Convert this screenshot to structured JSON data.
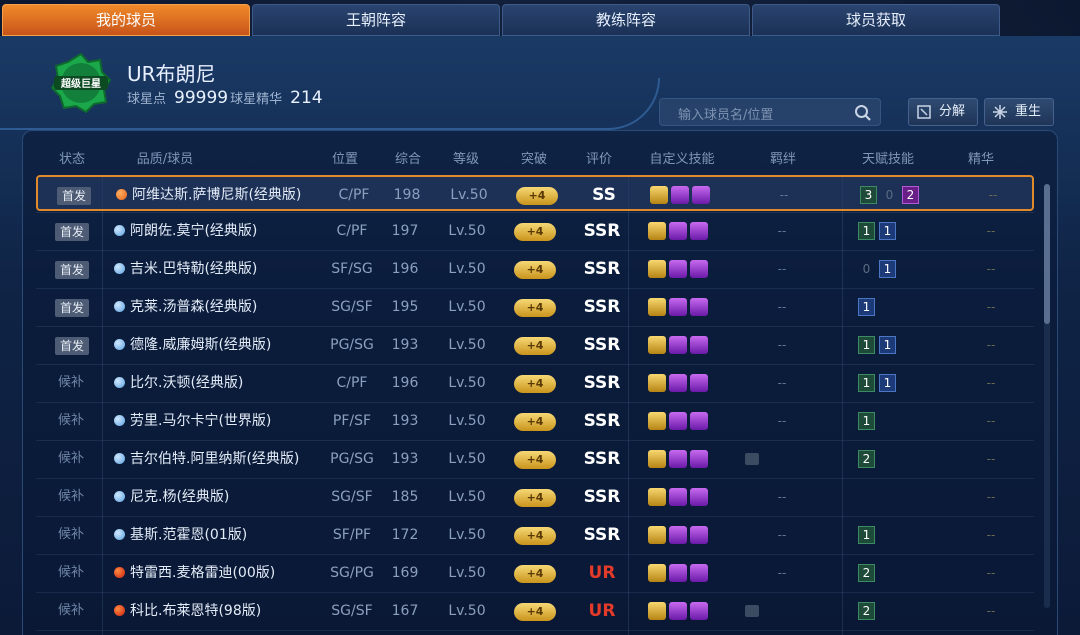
{
  "tabs": [
    "我的球员",
    "王朝阵容",
    "教练阵容",
    "球员获取"
  ],
  "player": {
    "badge_text": "超级巨星",
    "name": "UR布朗尼",
    "star_points_label": "球星点",
    "star_points": "99999",
    "essence_label": "球星精华",
    "essence": "214"
  },
  "search": {
    "placeholder": "输入球员名/位置"
  },
  "buttons": {
    "decompose": "分解",
    "rebirth": "重生"
  },
  "columns": [
    "状态",
    "品质/球员",
    "位置",
    "综合",
    "等级",
    "突破",
    "评价",
    "自定义技能",
    "羁绊",
    "天赋技能",
    "精华"
  ],
  "rows": [
    {
      "status": "首发",
      "name": "阿维达斯.萨博尼斯(经典版)",
      "dot": "orange",
      "pos": "C/PF",
      "ovr": "198",
      "lv": "Lv.50",
      "brk": "+4",
      "grade": "SS",
      "bond": "--",
      "talents": [
        [
          "g",
          "3"
        ],
        [
          "z",
          "0"
        ],
        [
          "p",
          "2"
        ]
      ],
      "ess": "--"
    },
    {
      "status": "首发",
      "name": "阿朗佐.莫宁(经典版)",
      "dot": "blue",
      "pos": "C/PF",
      "ovr": "197",
      "lv": "Lv.50",
      "brk": "+4",
      "grade": "SSR",
      "bond": "--",
      "talents": [
        [
          "g",
          "1"
        ],
        [
          "b",
          "1"
        ]
      ],
      "ess": "--"
    },
    {
      "status": "首发",
      "name": "吉米.巴特勒(经典版)",
      "dot": "blue",
      "pos": "SF/SG",
      "ovr": "196",
      "lv": "Lv.50",
      "brk": "+4",
      "grade": "SSR",
      "bond": "--",
      "talents": [
        [
          "z",
          "0"
        ],
        [
          "b",
          "1"
        ]
      ],
      "ess": "--"
    },
    {
      "status": "首发",
      "name": "克莱.汤普森(经典版)",
      "dot": "blue",
      "pos": "SG/SF",
      "ovr": "195",
      "lv": "Lv.50",
      "brk": "+4",
      "grade": "SSR",
      "bond": "--",
      "talents": [
        [
          "b",
          "1"
        ]
      ],
      "ess": "--"
    },
    {
      "status": "首发",
      "name": "德隆.威廉姆斯(经典版)",
      "dot": "blue",
      "pos": "PG/SG",
      "ovr": "193",
      "lv": "Lv.50",
      "brk": "+4",
      "grade": "SSR",
      "bond": "--",
      "talents": [
        [
          "g",
          "1"
        ],
        [
          "b",
          "1"
        ]
      ],
      "ess": "--"
    },
    {
      "status": "候补",
      "name": "比尔.沃顿(经典版)",
      "dot": "blue",
      "pos": "C/PF",
      "ovr": "196",
      "lv": "Lv.50",
      "brk": "+4",
      "grade": "SSR",
      "bond": "--",
      "talents": [
        [
          "g",
          "1"
        ],
        [
          "b",
          "1"
        ]
      ],
      "ess": "--"
    },
    {
      "status": "候补",
      "name": "劳里.马尔卡宁(世界版)",
      "dot": "blue",
      "pos": "PF/SF",
      "ovr": "193",
      "lv": "Lv.50",
      "brk": "+4",
      "grade": "SSR",
      "bond": "--",
      "talents": [
        [
          "g",
          "1"
        ]
      ],
      "ess": "--"
    },
    {
      "status": "候补",
      "name": "吉尔伯特.阿里纳斯(经典版)",
      "dot": "blue",
      "pos": "PG/SG",
      "ovr": "193",
      "lv": "Lv.50",
      "brk": "+4",
      "grade": "SSR",
      "bond": "",
      "bond_icon": true,
      "talents": [
        [
          "g",
          "2"
        ]
      ],
      "ess": "--"
    },
    {
      "status": "候补",
      "name": "尼克.杨(经典版)",
      "dot": "blue",
      "pos": "SG/SF",
      "ovr": "185",
      "lv": "Lv.50",
      "brk": "+4",
      "grade": "SSR",
      "bond": "--",
      "talents": [],
      "ess": "--"
    },
    {
      "status": "候补",
      "name": "基斯.范霍恩(01版)",
      "dot": "blue",
      "pos": "SF/PF",
      "ovr": "172",
      "lv": "Lv.50",
      "brk": "+4",
      "grade": "SSR",
      "bond": "--",
      "talents": [
        [
          "g",
          "1"
        ]
      ],
      "ess": "--"
    },
    {
      "status": "候补",
      "name": "特雷西.麦格雷迪(00版)",
      "dot": "red",
      "pos": "SG/PG",
      "ovr": "169",
      "lv": "Lv.50",
      "brk": "+4",
      "grade": "UR",
      "bond": "--",
      "talents": [
        [
          "g",
          "2"
        ]
      ],
      "ess": "--"
    },
    {
      "status": "候补",
      "name": "科比.布莱恩特(98版)",
      "dot": "red",
      "pos": "SG/SF",
      "ovr": "167",
      "lv": "Lv.50",
      "brk": "+4",
      "grade": "UR",
      "bond": "",
      "bond_icon": true,
      "talents": [
        [
          "g",
          "2"
        ]
      ],
      "ess": "--"
    }
  ],
  "colors": {
    "accent": "#e8892a",
    "gold": "#d9a52a",
    "ur_red": "#e43a2a",
    "purple_skill": "#9a3ed0"
  }
}
